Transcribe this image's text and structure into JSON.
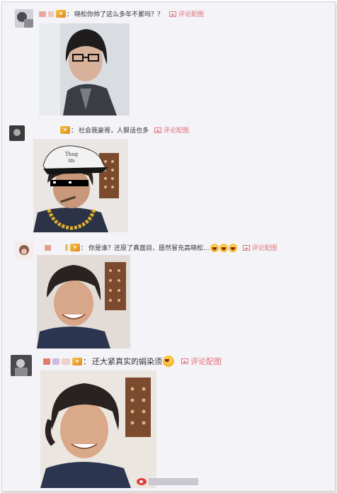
{
  "comments": [
    {
      "text": "晓松你帅了这么多年不累吗？？",
      "link": "评论配图"
    },
    {
      "text": "社会我豪哥，人狠话也多",
      "link": "评论配图"
    },
    {
      "text": "你是谁？还原了真面目，居然冒充高晓松...",
      "link": "评论配图"
    },
    {
      "text": "还大紧真实的娟染须",
      "link": "评论配图"
    }
  ],
  "colors": {
    "frame_bg": "#f4f3f8",
    "link": "#e0737a",
    "text": "#333333"
  },
  "icons": [
    "picture-icon",
    "vip-badge-icon",
    "laugh-emoji-icon",
    "dizzy-emoji-icon",
    "weibo-logo-icon"
  ]
}
